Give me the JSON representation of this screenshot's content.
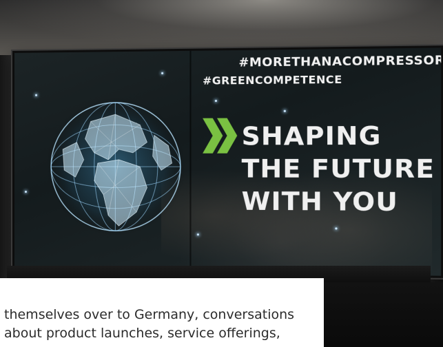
{
  "display": {
    "hashtag_1": "#MORETHANACOMPRESSOR",
    "hashtag_2": "#GREENCOMPETENCE",
    "headline_line_1": "SHAPING",
    "headline_line_2": "THE FUTURE",
    "headline_line_3": "WITH YOU"
  },
  "caption": {
    "line_1": "themselves over to Germany, conversations",
    "line_2": "about product launches, service offerings,"
  },
  "colors": {
    "chevron_green": "#7ac142",
    "globe_glow": "#9fd8ff"
  },
  "icons": {
    "globe": "wireframe-globe-icon",
    "chevrons": "double-chevron-icon"
  }
}
